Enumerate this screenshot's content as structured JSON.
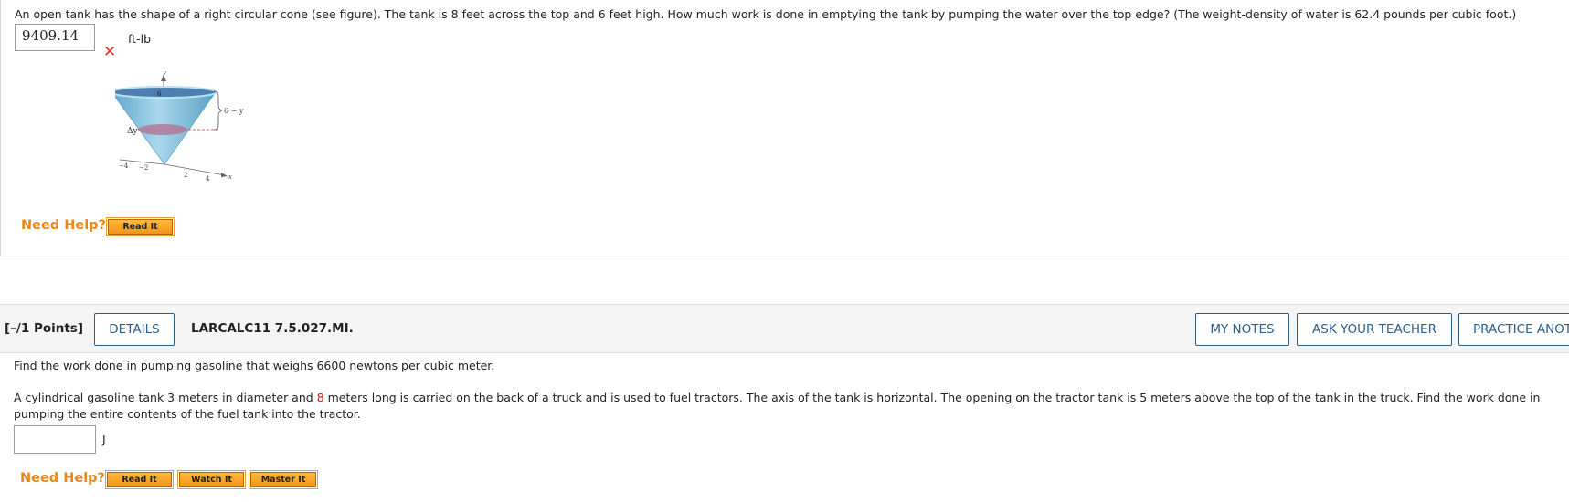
{
  "question1": {
    "text": "An open tank has the shape of a right circular cone (see figure). The tank is 8 feet across the top and 6 feet high. How much work is done in emptying the tank by pumping the water over the top edge? (The weight-density of water is 62.4 pounds per cubic foot.)",
    "answer_value": "9409.14",
    "unit": "ft-lb",
    "status_icon": "incorrect-x-icon",
    "figure_labels": {
      "y_axis": "y",
      "x_axis": "x",
      "top_tick": "6",
      "delta_y": "Δy",
      "distance": "6 − y",
      "tick_neg4": "−4",
      "tick_neg2": "−2",
      "tick_2": "2",
      "tick_4": "4"
    },
    "need_help_label": "Need Help?",
    "help_buttons": [
      "Read It"
    ]
  },
  "question2_header": {
    "points": "[–/1 Points]",
    "details_label": "DETAILS",
    "problem_code": "LARCALC11 7.5.027.MI.",
    "my_notes_label": "MY NOTES",
    "ask_teacher_label": "ASK YOUR TEACHER",
    "practice_label": "PRACTICE ANOTHER"
  },
  "question2": {
    "line1": "Find the work done in pumping gasoline that weighs 6600 newtons per cubic meter.",
    "para_part1": "A cylindrical gasoline tank 3 meters in diameter and ",
    "para_highlight": "8",
    "para_part2": " meters long is carried on the back of a truck and is used to fuel tractors. The axis of the tank is horizontal. The opening on the tractor tank is 5 meters above the top of the tank in the truck. Find the work done in pumping the entire contents of the fuel tank into the tractor.",
    "answer_value": "",
    "unit": "J",
    "need_help_label": "Need Help?",
    "help_buttons": [
      "Read It",
      "Watch It",
      "Master It"
    ]
  },
  "colors": {
    "need_help": "#e8891a",
    "button_orange": "#f2941a",
    "link_blue": "#2b5f8a",
    "highlight_red": "#d0201c",
    "incorrect_red": "#e0322e"
  }
}
